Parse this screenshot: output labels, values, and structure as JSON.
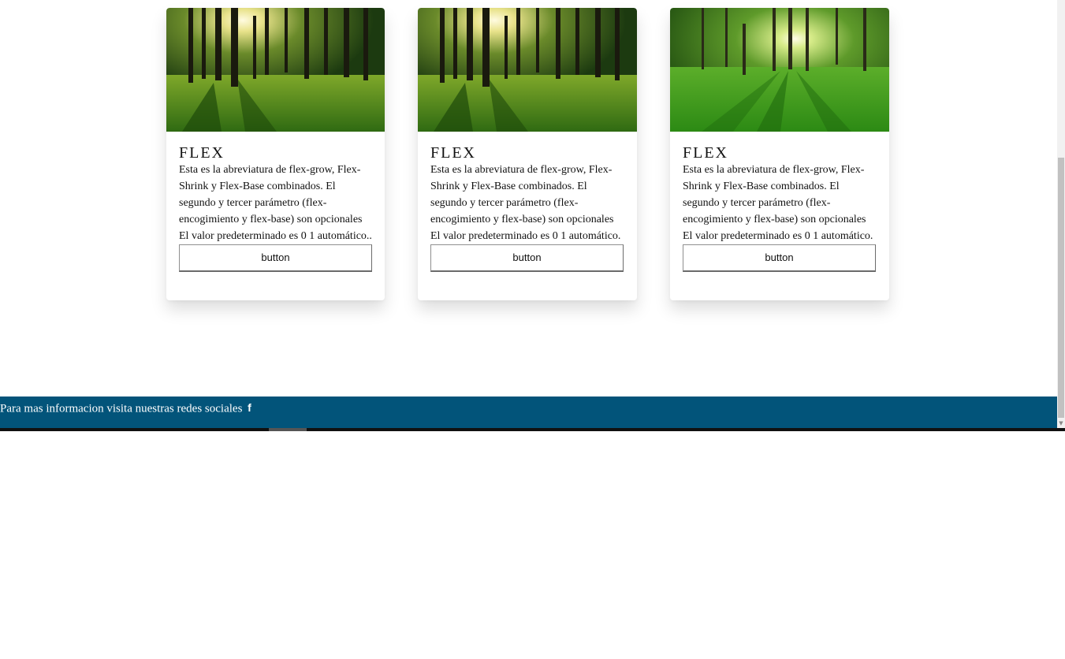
{
  "cards": [
    {
      "image": "forest-sunlight-image",
      "title": "FLEX",
      "text": "Esta es la abreviatura de flex-grow, Flex-Shrink y Flex-Base combinados. El segundo y tercer parámetro (flex-encogimiento y flex-base) son opcionales El valor predeterminado es 0 1 automático..",
      "button_label": "button"
    },
    {
      "image": "forest-sunlight-image",
      "title": "FLEX",
      "text": "Esta es la abreviatura de flex-grow, Flex-Shrink y Flex-Base combinados. El segundo y tercer parámetro (flex-encogimiento y flex-base) son opcionales El valor predeterminado es 0 1 automático.",
      "button_label": "button"
    },
    {
      "image": "green-park-image",
      "title": "FLEX",
      "text": "Esta es la abreviatura de flex-grow, Flex-Shrink y Flex-Base combinados. El segundo y tercer parámetro (flex-encogimiento y flex-base) son opcionales El valor predeterminado es 0 1 automático.",
      "button_label": "button"
    }
  ],
  "footer": {
    "text": "Para mas informacion visita nuestras redes sociales",
    "social_icon": "facebook-icon",
    "social_glyph": "f",
    "background_color": "#02547a"
  }
}
